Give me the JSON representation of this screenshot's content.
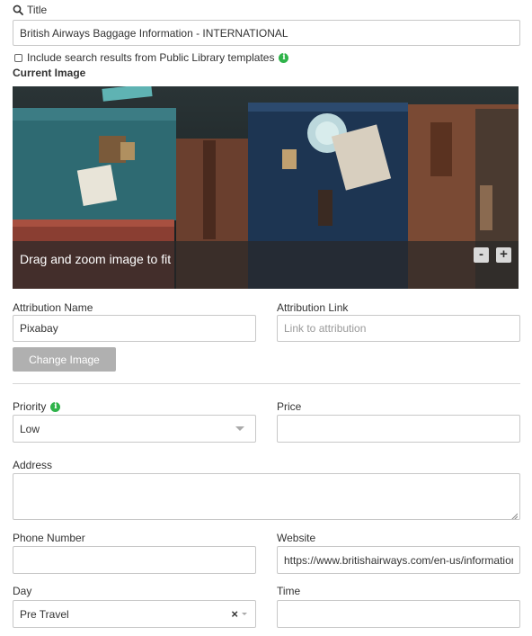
{
  "title_field": {
    "label": "Title",
    "value": "British Airways Baggage Information - INTERNATIONAL"
  },
  "public_library": {
    "label": "Include search results from Public Library templates",
    "checked": false
  },
  "image": {
    "section_label": "Current Image",
    "overlay_text": "Drag and zoom image to fit",
    "zoom_out_label": "-",
    "zoom_in_label": "+"
  },
  "attribution": {
    "name_label": "Attribution Name",
    "name_value": "Pixabay",
    "link_label": "Attribution Link",
    "link_placeholder": "Link to attribution"
  },
  "change_image_button": "Change Image",
  "priority": {
    "label": "Priority",
    "value": "Low"
  },
  "price": {
    "label": "Price",
    "value": ""
  },
  "address": {
    "label": "Address",
    "value": ""
  },
  "phone": {
    "label": "Phone Number",
    "value": ""
  },
  "website": {
    "label": "Website",
    "value": "https://www.britishairways.com/en-us/information"
  },
  "day": {
    "label": "Day",
    "value": "Pre Travel",
    "clear_icon": "×"
  },
  "time": {
    "label": "Time",
    "value": ""
  },
  "icons": {
    "search": "search-icon",
    "info": "info-icon",
    "resize": "resize-handle-icon",
    "dropdown": "chevron-down-icon"
  },
  "colors": {
    "info_green": "#2fb34a",
    "button_gray": "#b0b0b0",
    "image_overlay": "rgba(40,40,40,0.72)"
  }
}
